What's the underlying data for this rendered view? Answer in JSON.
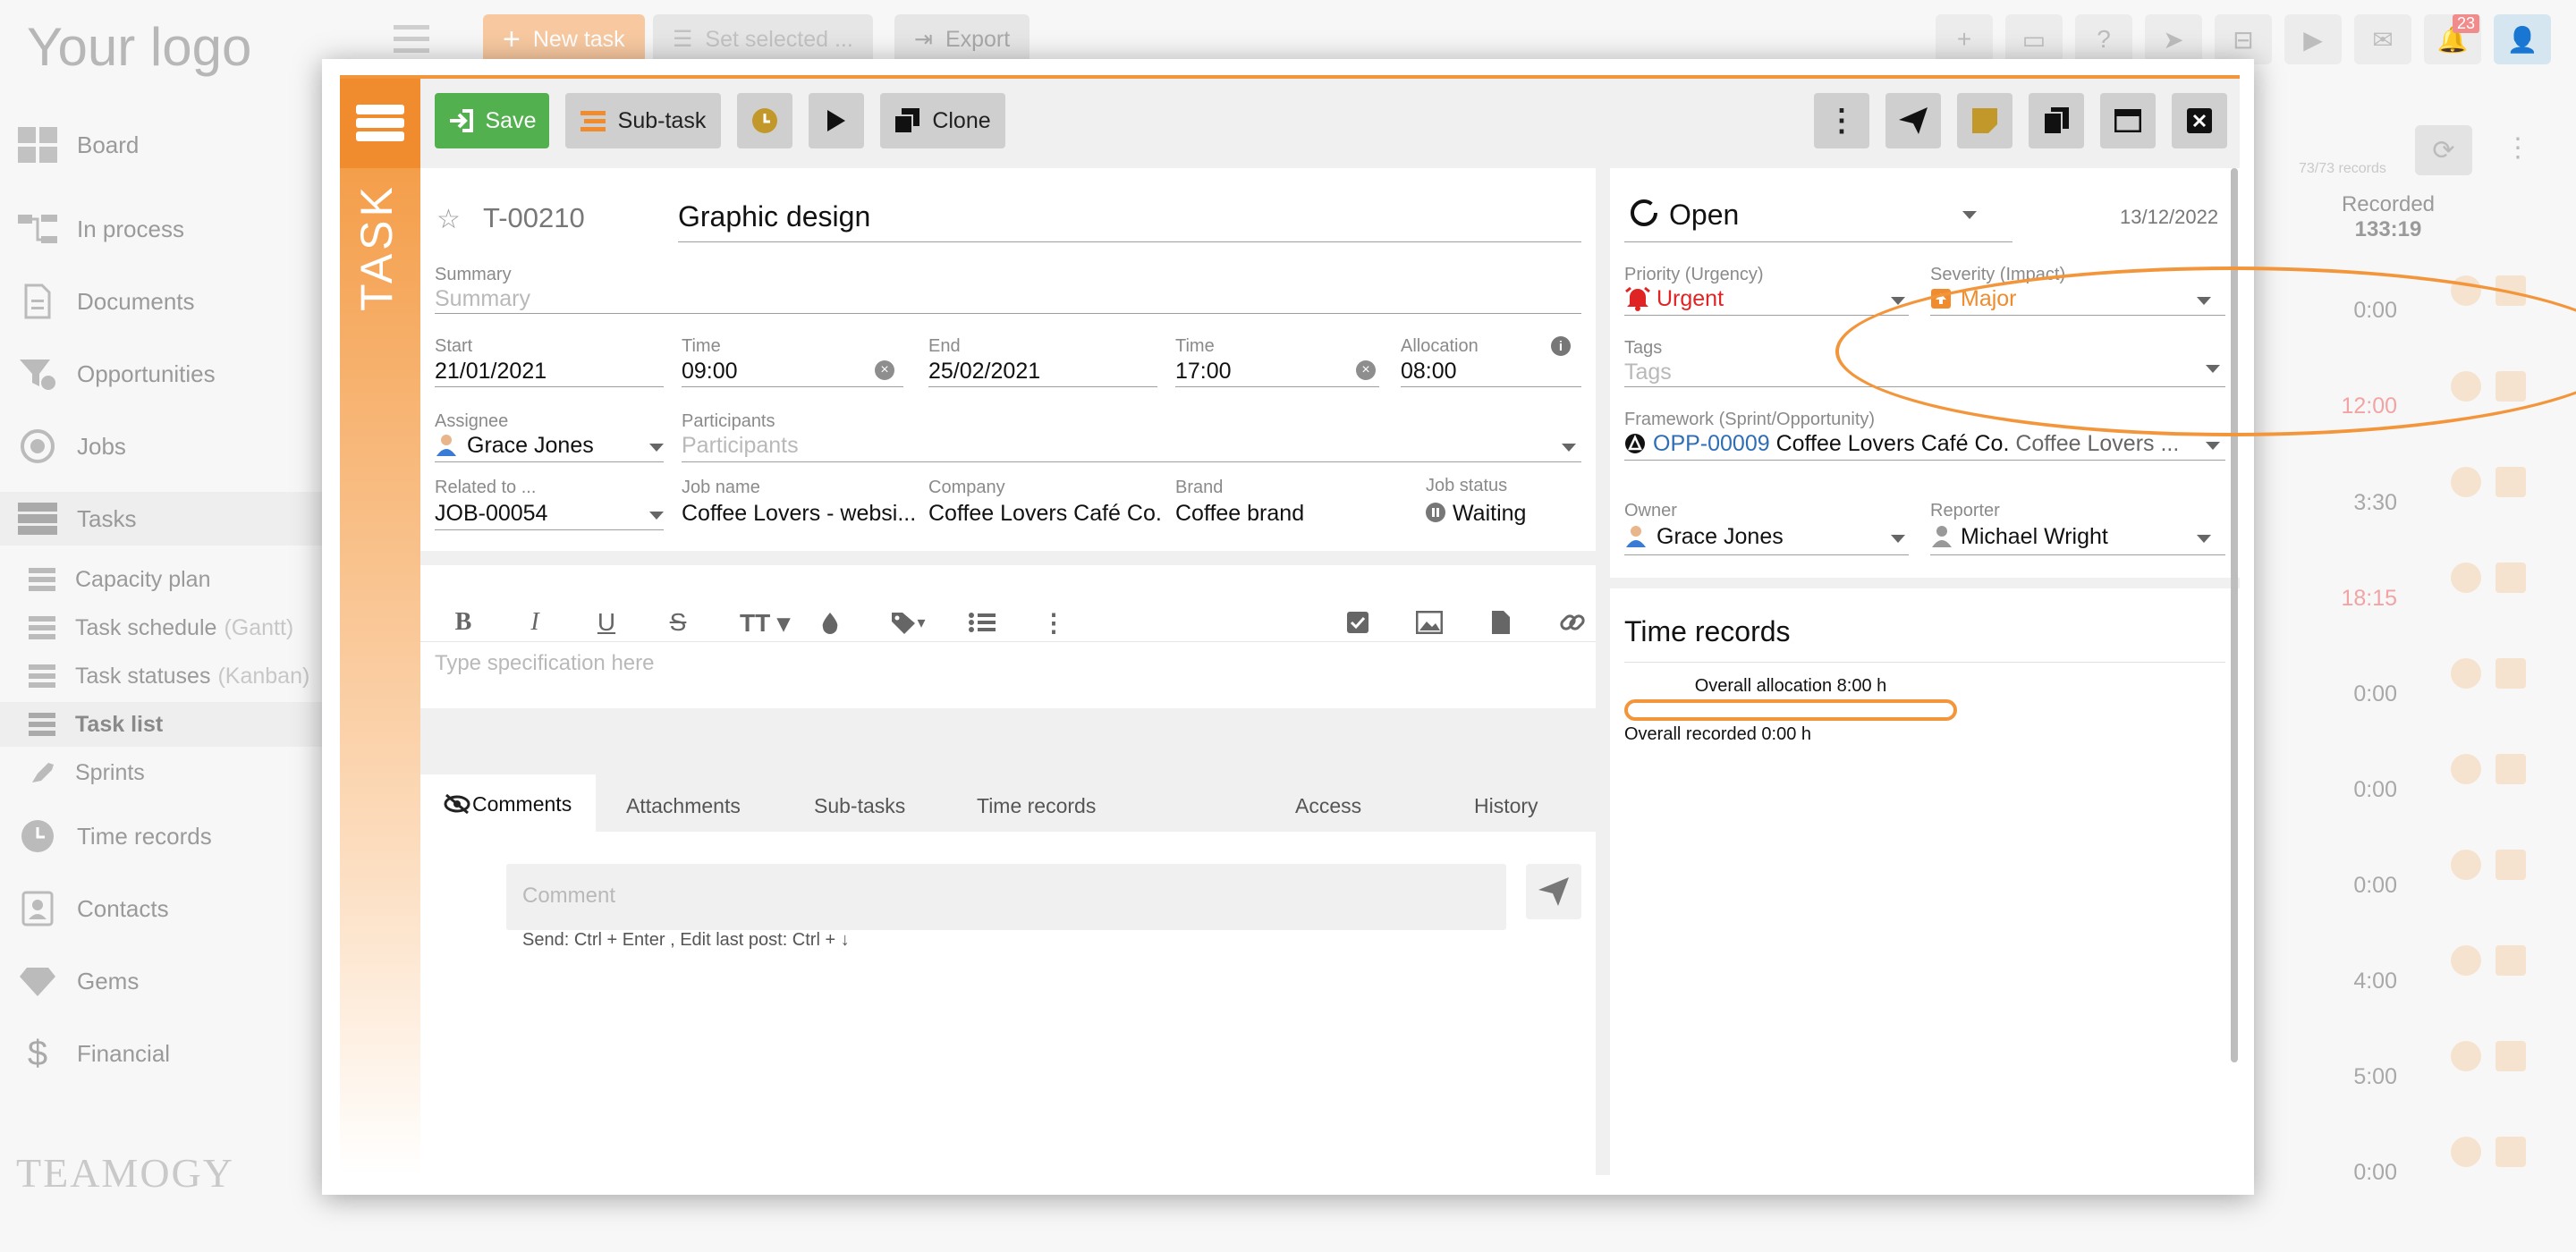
{
  "background": {
    "logo": "Your logo",
    "topbar": {
      "new_task": "New task",
      "set_selected": "Set selected ...",
      "export": "Export",
      "notifications": "23"
    },
    "sidebar": [
      {
        "label": "Board"
      },
      {
        "label": "In process"
      },
      {
        "label": "Documents"
      },
      {
        "label": "Opportunities"
      },
      {
        "label": "Jobs"
      },
      {
        "label": "Tasks"
      },
      {
        "label": "Capacity plan"
      },
      {
        "label": "Task schedule",
        "suffix": "(Gantt)"
      },
      {
        "label": "Task statuses",
        "suffix": "(Kanban)"
      },
      {
        "label": "Task list"
      },
      {
        "label": "Sprints"
      },
      {
        "label": "Time records"
      },
      {
        "label": "Contacts"
      },
      {
        "label": "Gems"
      },
      {
        "label": "Financial"
      }
    ],
    "teamogy": "TEAMOGY",
    "records_count": "73/73 records",
    "recorded_header": "Recorded",
    "recorded_total": "133:19",
    "recorded_values": [
      "0:00",
      "12:00",
      "3:30",
      "18:15",
      "0:00",
      "0:00",
      "0:00",
      "4:00",
      "5:00",
      "0:00"
    ]
  },
  "modal": {
    "side_label": "TASK",
    "toolbar": {
      "save": "Save",
      "subtask": "Sub-task",
      "clone": "Clone"
    },
    "task": {
      "id": "T-00210",
      "name": "Graphic design",
      "summary_label": "Summary",
      "summary_placeholder": "Summary",
      "start_label": "Start",
      "start_value": "21/01/2021",
      "start_time_label": "Time",
      "start_time": "09:00",
      "end_label": "End",
      "end_value": "25/02/2021",
      "end_time_label": "Time",
      "end_time": "17:00",
      "allocation_label": "Allocation",
      "allocation_value": "08:00",
      "assignee_label": "Assignee",
      "assignee_value": "Grace Jones",
      "participants_label": "Participants",
      "participants_placeholder": "Participants",
      "related_label": "Related to ...",
      "related_value": "JOB-00054",
      "jobname_label": "Job name",
      "jobname_value": "Coffee Lovers - websi...",
      "company_label": "Company",
      "company_value": "Coffee Lovers Café Co.",
      "brand_label": "Brand",
      "brand_value": "Coffee brand",
      "jobstatus_label": "Job status",
      "jobstatus_value": "Waiting"
    },
    "editor": {
      "placeholder": "Type specification here"
    },
    "tabs": [
      "Comments",
      "Attachments",
      "Sub-tasks",
      "Time records",
      "Access",
      "History"
    ],
    "comment": {
      "placeholder": "Comment",
      "hint": "Send: Ctrl + Enter , Edit last post: Ctrl + ↓"
    },
    "right": {
      "status": "Open",
      "date": "13/12/2022",
      "priority_label": "Priority (Urgency)",
      "priority_value": "Urgent",
      "severity_label": "Severity (Impact)",
      "severity_value": "Major",
      "tags_label": "Tags",
      "tags_placeholder": "Tags",
      "framework_label": "Framework (Sprint/Opportunity)",
      "framework_id": "OPP-00009",
      "framework_company": "Coffee Lovers Café Co.",
      "framework_extra": "Coffee Lovers ...",
      "owner_label": "Owner",
      "owner_value": "Grace Jones",
      "reporter_label": "Reporter",
      "reporter_value": "Michael Wright"
    },
    "time_records": {
      "title": "Time records",
      "allocation_text": "Overall allocation 8:00 h",
      "recorded_text": "Overall recorded 0:00 h"
    },
    "colors": {
      "accent": "#f3963b",
      "save_green": "#52b04e",
      "urgent_red": "#e02424",
      "major_orange": "#f08c2e",
      "link_blue": "#2f6db5"
    }
  }
}
